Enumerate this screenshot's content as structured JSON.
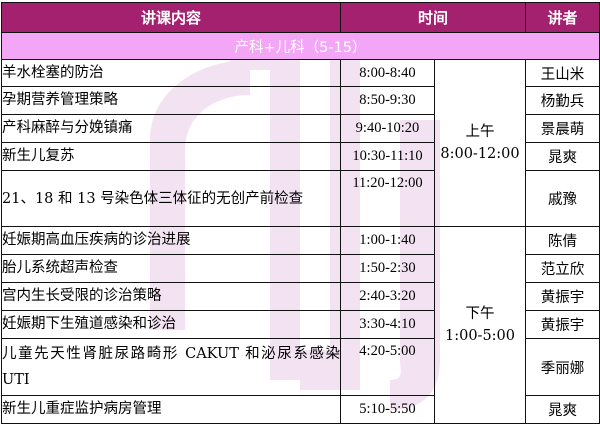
{
  "header": {
    "topic": "讲课内容",
    "time": "时间",
    "speaker": "讲者"
  },
  "section": {
    "title": "产科+儿科（5-15）"
  },
  "periods": [
    {
      "label": "上午",
      "range": "8:00-12:00"
    },
    {
      "label": "下午",
      "range": "1:00-5:00"
    }
  ],
  "rows": [
    {
      "topic": "羊水栓塞的防治",
      "time": "8:00-8:40",
      "speaker": "王山米"
    },
    {
      "topic": "孕期营养管理策略",
      "time": "8:50-9:30",
      "speaker": "杨勤兵"
    },
    {
      "topic": "产科麻醉与分娩镇痛",
      "time": "9:40-10:20",
      "speaker": "景晨萌"
    },
    {
      "topic": "新生儿复苏",
      "time": "10:30-11:10",
      "speaker": "晁爽"
    },
    {
      "topic": "21、18 和 13 号染色体三体征的无创产前检查",
      "time": "11:20-12:00",
      "speaker": "戚豫"
    },
    {
      "topic": "妊娠期高血压疾病的诊治进展",
      "time": "1:00-1:40",
      "speaker": "陈倩"
    },
    {
      "topic": "胎儿系统超声检查",
      "time": "1:50-2:30",
      "speaker": "范立欣"
    },
    {
      "topic": "宫内生长受限的诊治策略",
      "time": "2:40-3:20",
      "speaker": "黄振宇"
    },
    {
      "topic": "妊娠期下生殖道感染和诊治",
      "time": "3:30-4:10",
      "speaker": "黄振宇"
    },
    {
      "topic": "儿童先天性肾脏尿路畸形 CAKUT 和泌尿系感染 UTI",
      "time": "4:20-5:00",
      "speaker": "季丽娜"
    },
    {
      "topic": "新生儿重症监护病房管理",
      "time": "5:10-5:50",
      "speaker": "晁爽"
    }
  ],
  "colors": {
    "header_bg": "#a3216f",
    "section_bg": "#f3a6f6",
    "watermark": "#f1def0"
  }
}
